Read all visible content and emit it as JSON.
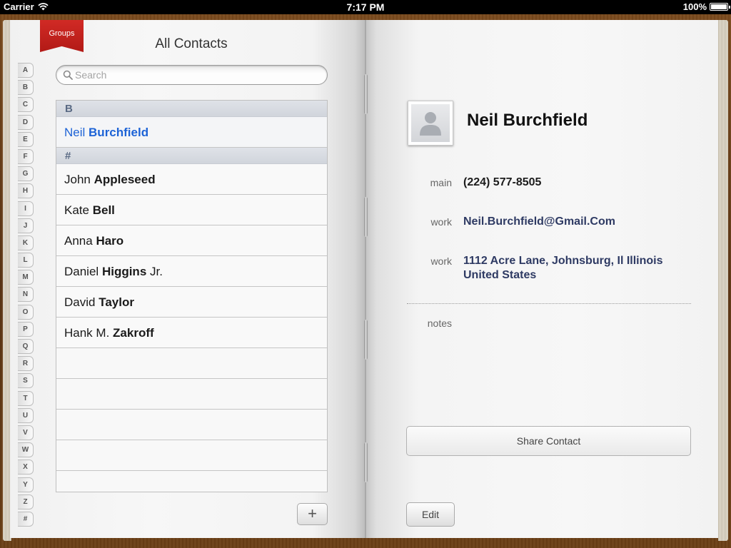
{
  "status_bar": {
    "carrier": "Carrier",
    "time": "7:17 PM",
    "battery_text": "100%",
    "battery_level": 1.0
  },
  "groups_label": "Groups",
  "contacts": {
    "title": "All Contacts",
    "search_placeholder": "Search",
    "alphabet": [
      "A",
      "B",
      "C",
      "D",
      "E",
      "F",
      "G",
      "H",
      "I",
      "J",
      "K",
      "L",
      "M",
      "N",
      "O",
      "P",
      "Q",
      "R",
      "S",
      "T",
      "U",
      "V",
      "W",
      "X",
      "Y",
      "Z",
      "#"
    ],
    "sections": [
      {
        "header": "B",
        "rows": [
          {
            "first": "Neil",
            "last": "Burchfield",
            "suffix": "",
            "selected": true
          }
        ]
      },
      {
        "header": "#",
        "rows": [
          {
            "first": "John",
            "last": "Appleseed",
            "suffix": "",
            "selected": false
          },
          {
            "first": "Kate",
            "last": "Bell",
            "suffix": "",
            "selected": false
          },
          {
            "first": "Anna",
            "last": "Haro",
            "suffix": "",
            "selected": false
          },
          {
            "first": "Daniel",
            "last": "Higgins",
            "suffix": "Jr.",
            "selected": false
          },
          {
            "first": "David",
            "last": "Taylor",
            "suffix": "",
            "selected": false
          },
          {
            "first": "Hank M.",
            "last": "Zakroff",
            "suffix": "",
            "selected": false
          }
        ]
      }
    ],
    "add_button_label": "+"
  },
  "detail": {
    "name": "Neil Burchfield",
    "fields": {
      "phone_label": "main",
      "phone_value": "(224) 577-8505",
      "email_label": "work",
      "email_value": "Neil.Burchfield@Gmail.Com",
      "address_label": "work",
      "address_line1": "1112 Acre Lane, Johnsburg, Il Illinois",
      "address_line2": "United States",
      "notes_label": "notes"
    },
    "share_button_label": "Share Contact",
    "edit_button_label": "Edit"
  },
  "colors": {
    "selected_contact": "#1d63d6",
    "groups_ribbon": "#c0201c",
    "detail_link": "#2e3a63"
  }
}
